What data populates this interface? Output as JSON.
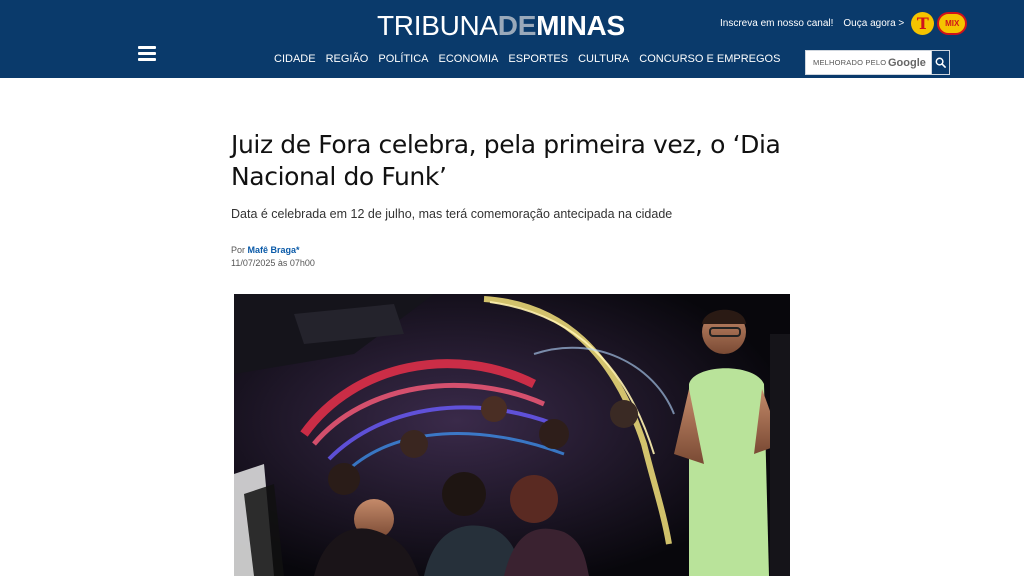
{
  "header": {
    "logo": {
      "part1": "TRIBUNA",
      "part2": "DE",
      "part3": "MINAS"
    },
    "subscribe_link": "Inscreva em nosso canal!",
    "listen_link": "Ouça agora >",
    "radio_badges": [
      "T",
      "MIX"
    ],
    "nav": [
      "CIDADE",
      "REGIÃO",
      "POLÍTICA",
      "ECONOMIA",
      "ESPORTES",
      "CULTURA",
      "CONCURSO E EMPREGOS"
    ],
    "search": {
      "placeholder": "MELHORADO PELO",
      "brand": "Google"
    },
    "colors": {
      "bar": "#0a3a6b",
      "logo_accent": "#9aa9ba"
    }
  },
  "article": {
    "headline": "Juiz de Fora celebra, pela primeira vez, o ‘Dia Nacional do Funk’",
    "subhead": "Data é celebrada em 12 de julho, mas terá comemoração antecipada na cidade",
    "byline_prefix": "Por",
    "author": "Mafê Braga*",
    "date": "11/07/2025 às 07h00"
  }
}
